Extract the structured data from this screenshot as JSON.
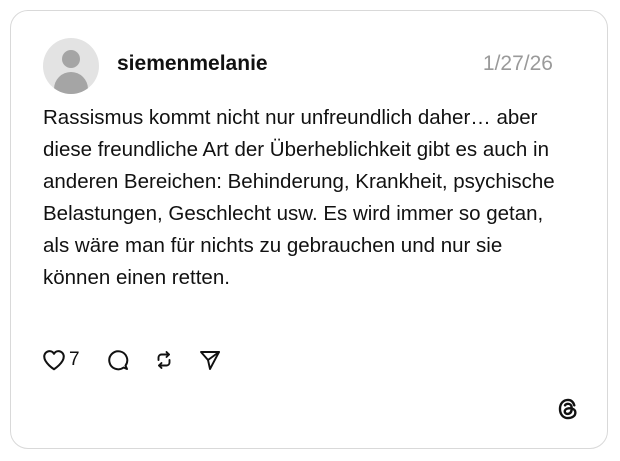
{
  "post": {
    "username": "siemenmelanie",
    "date": "1/27/26",
    "text": "Rassismus kommt nicht nur unfreundlich daher… aber diese freundliche Art der Überheblichkeit gibt es auch in anderen Bereichen: Behinderung, Krankheit, psychische Belastungen, Geschlecht usw. Es wird immer so getan, als wäre man für nichts zu gebrauchen und nur sie können einen retten.",
    "like_count": "7"
  },
  "icons": {
    "avatar": "default-avatar-icon",
    "like": "heart-icon",
    "reply": "comment-icon",
    "repost": "repost-icon",
    "share": "send-icon",
    "brand": "threads-logo-icon"
  },
  "colors": {
    "text": "#111111",
    "muted": "#9a9a9a",
    "border": "#d9d9d9",
    "avatar_bg": "#e3e3e3",
    "avatar_fg": "#a5a5a5"
  }
}
